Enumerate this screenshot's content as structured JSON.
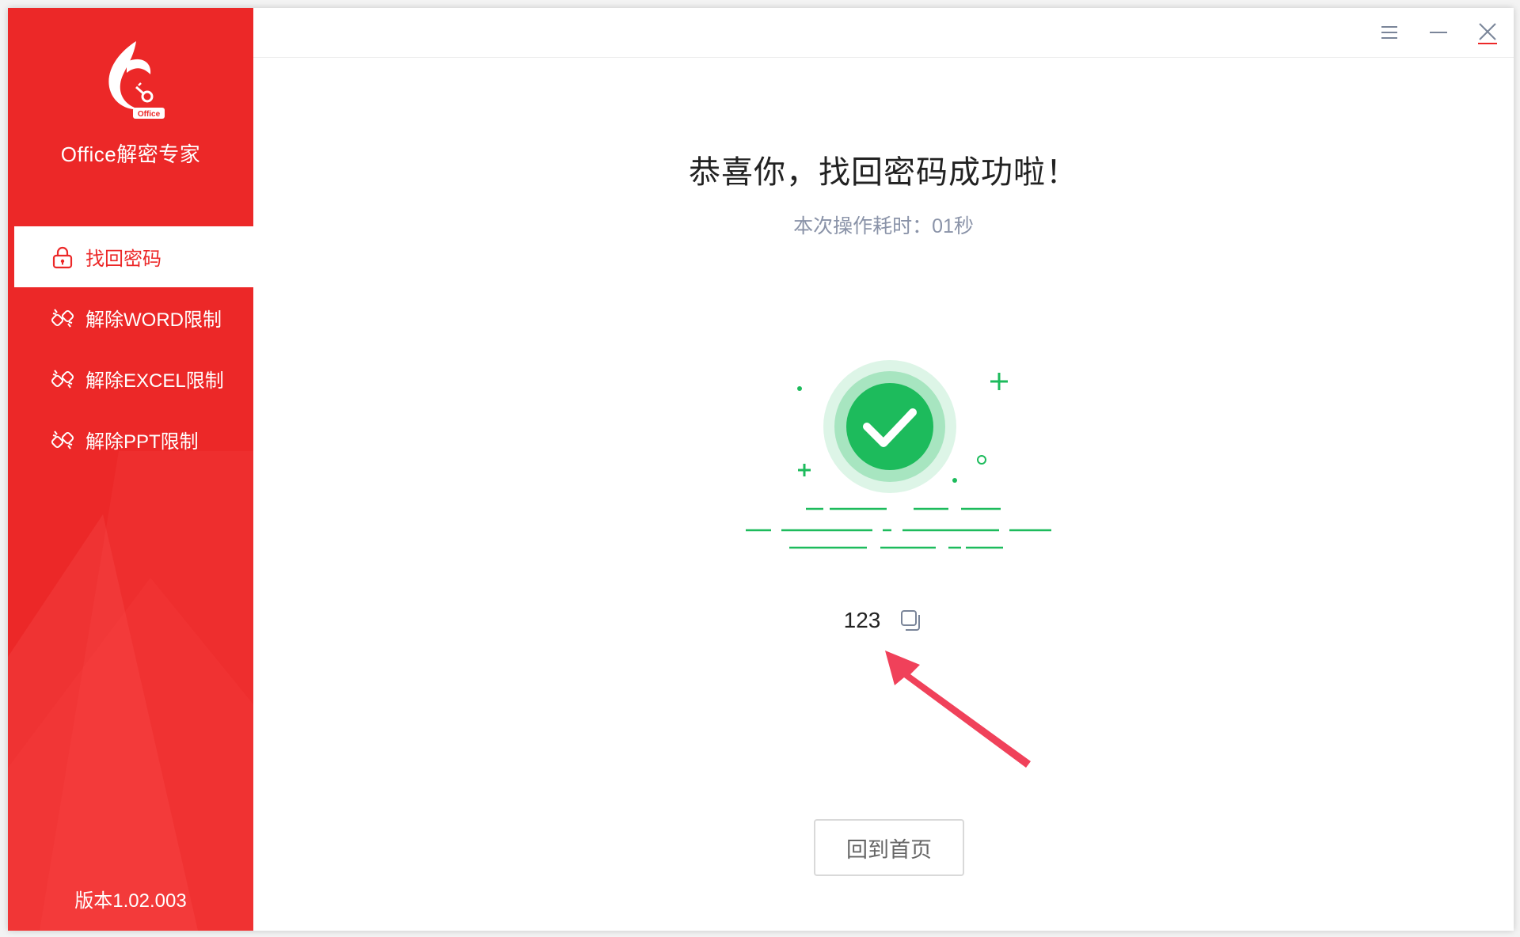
{
  "app": {
    "name": "Office解密专家",
    "logo_badge": "Office",
    "version": "版本1.02.003"
  },
  "sidebar": {
    "items": [
      {
        "label": "找回密码",
        "icon": "lock-icon",
        "active": true
      },
      {
        "label": "解除WORD限制",
        "icon": "unlink-icon",
        "active": false
      },
      {
        "label": "解除EXCEL限制",
        "icon": "unlink-icon",
        "active": false
      },
      {
        "label": "解除PPT限制",
        "icon": "unlink-icon",
        "active": false
      }
    ]
  },
  "titlebar": {
    "buttons": [
      "menu-icon",
      "minimize-icon",
      "close-icon"
    ]
  },
  "result": {
    "headline": "恭喜你，找回密码成功啦！",
    "elapsed": "本次操作耗时：01秒",
    "password": "123",
    "home_button": "回到首页"
  },
  "colors": {
    "brand_red": "#ec2828",
    "success_green": "#1dbb5c",
    "arrow_red": "#f0415a"
  }
}
